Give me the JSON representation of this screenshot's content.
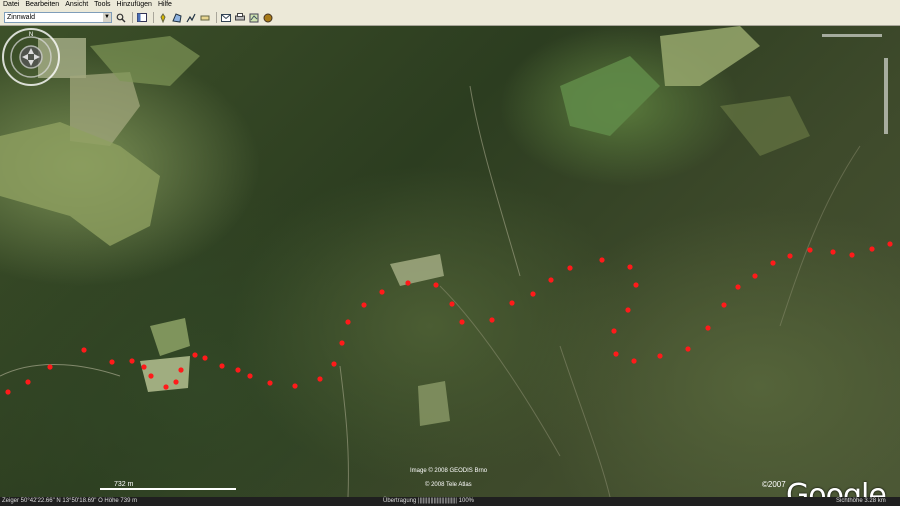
{
  "menu": [
    "Datei",
    "Bearbeiten",
    "Ansicht",
    "Tools",
    "Hinzufügen",
    "Hilfe"
  ],
  "search": {
    "value": "Zinnwald"
  },
  "toolbar_icons": [
    "search-go-icon",
    "sidebar-toggle-icon",
    "placemark-icon",
    "polygon-icon",
    "path-icon",
    "ruler-icon",
    "email-icon",
    "print-icon",
    "map-view-icon",
    "sky-icon"
  ],
  "map": {
    "credits": {
      "image": "Image © 2008 GEODIS Brno",
      "tele": "© 2008 Tele Atlas"
    },
    "scale_label": "732 m",
    "logo": "Google",
    "logo_year": "©2007",
    "track_color": "#ff1a1a"
  },
  "status": {
    "coords": "Zeiger  50°42'22.66\" N    13°50'18.69\" O    Höhe   739 m",
    "streaming": "Übertragung ||||||||||||||||||||||||| 100%",
    "eye_alt": "Sichthöhe    3.28 km"
  }
}
